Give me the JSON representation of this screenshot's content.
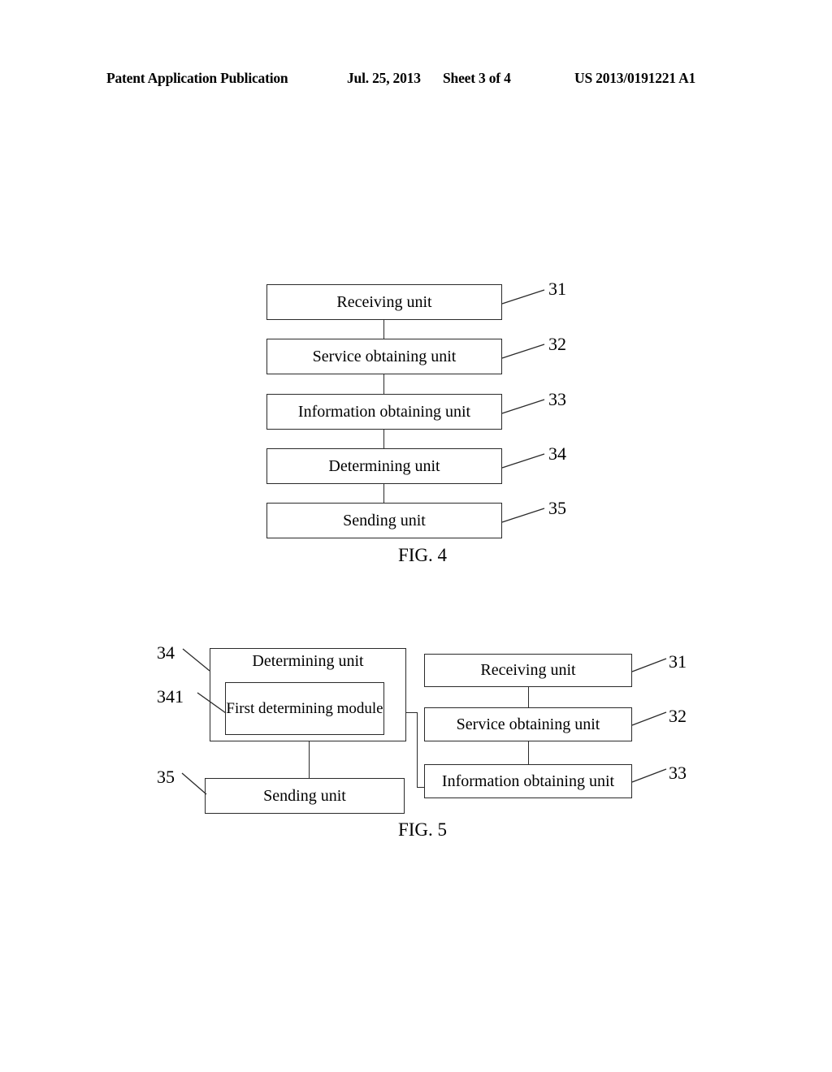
{
  "header": {
    "publication": "Patent Application Publication",
    "date": "Jul. 25, 2013",
    "sheet": "Sheet 3 of 4",
    "patent_number": "US 2013/0191221 A1"
  },
  "figures": [
    {
      "caption": "FIG. 4",
      "nodes": [
        {
          "ref": "31",
          "label": "Receiving unit"
        },
        {
          "ref": "32",
          "label": "Service obtaining unit"
        },
        {
          "ref": "33",
          "label": "Information obtaining unit"
        },
        {
          "ref": "34",
          "label": "Determining unit"
        },
        {
          "ref": "35",
          "label": "Sending unit"
        }
      ]
    },
    {
      "caption": "FIG. 5",
      "nodes": [
        {
          "ref": "34",
          "label": "Determining unit"
        },
        {
          "ref": "341",
          "label": "First determining module"
        },
        {
          "ref": "35",
          "label": "Sending unit"
        },
        {
          "ref": "31",
          "label": "Receiving unit"
        },
        {
          "ref": "32",
          "label": "Service obtaining unit"
        },
        {
          "ref": "33",
          "label": "Information obtaining unit"
        }
      ]
    }
  ],
  "style": {
    "line_color": "#2a2a2a",
    "page_background": "#ffffff",
    "text_color": "#000000"
  }
}
